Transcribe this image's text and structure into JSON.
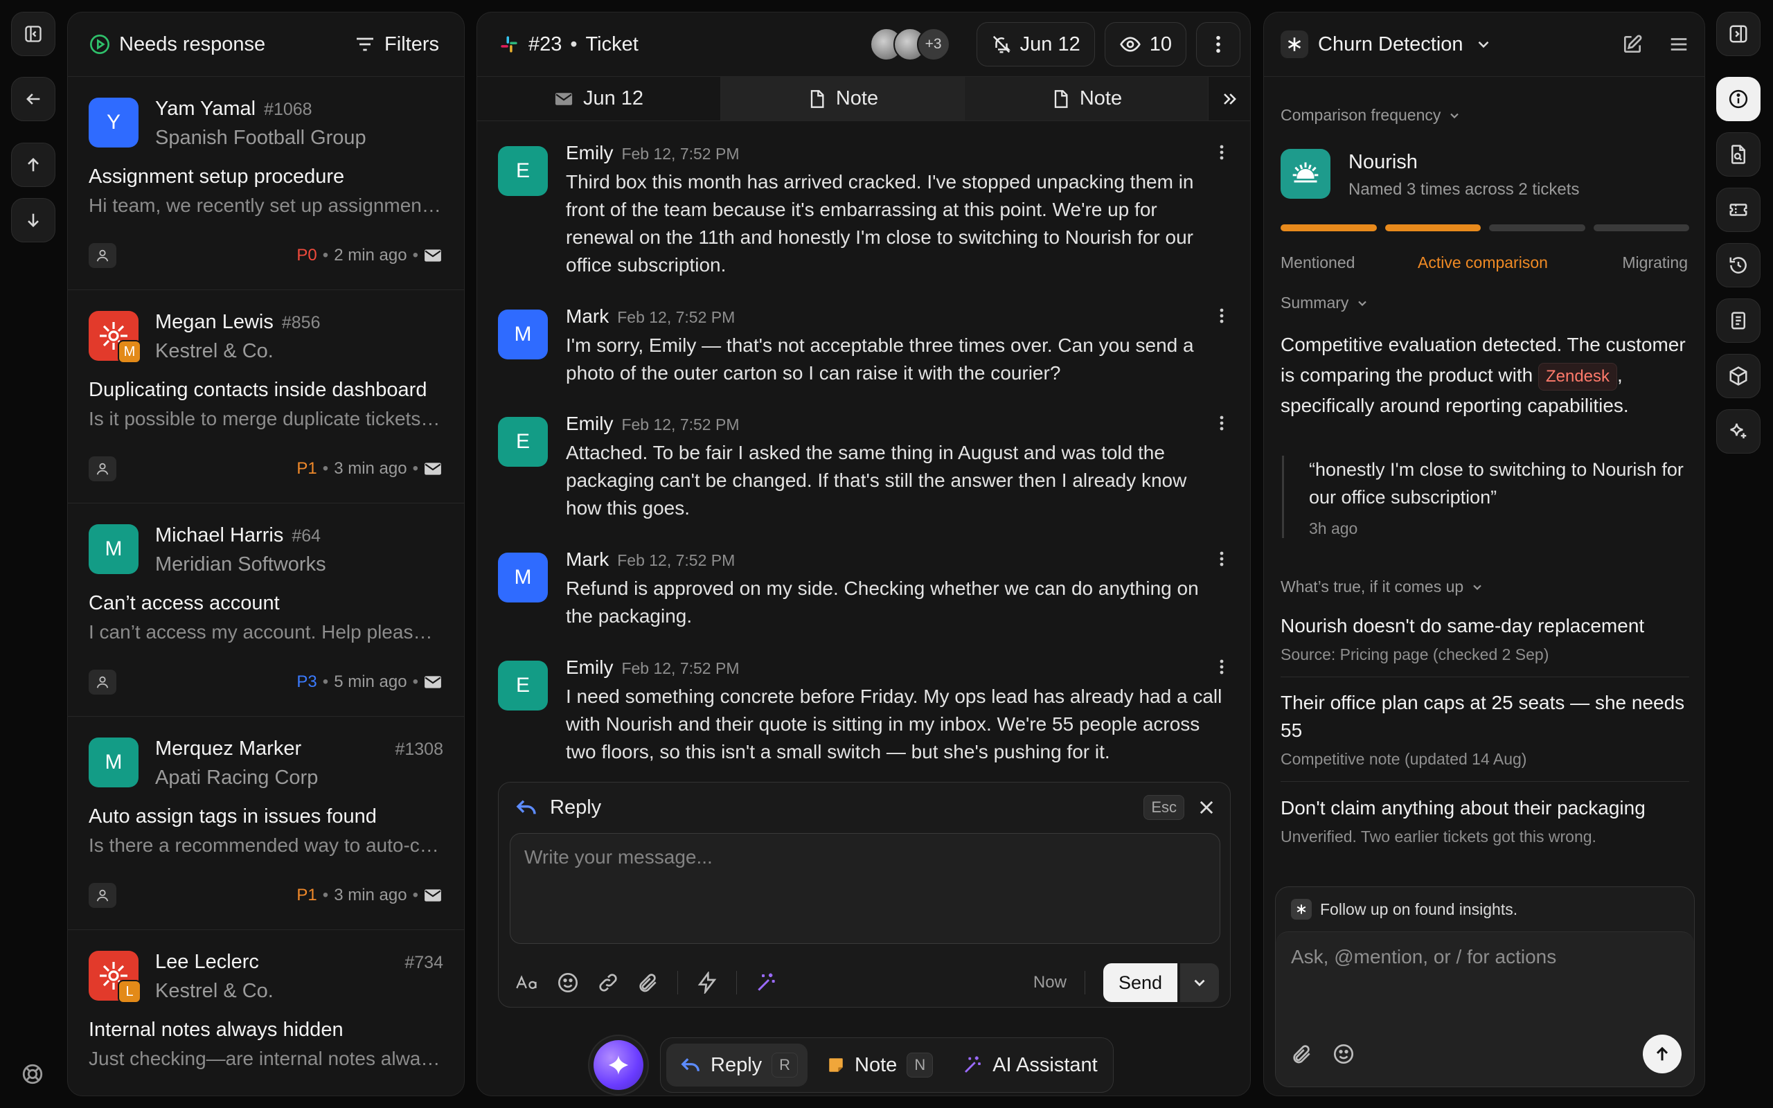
{
  "inbox": {
    "title": "Needs response",
    "filters_label": "Filters",
    "tickets": [
      {
        "initial": "Y",
        "avatar_color": "#2f6bff",
        "name": "Yam Yamal",
        "number": "#1068",
        "company": "Spanish Football Group",
        "subject": "Assignment setup procedure",
        "preview": "Hi team, we recently set up assignment rules for the support queue",
        "priority": "P0",
        "priority_color": "#ef4a3c",
        "time": "2 min ago"
      },
      {
        "initial": "M",
        "avatar_color": "#e23a2b",
        "name": "Megan Lewis",
        "number": "#856",
        "company": "Kestrel & Co.",
        "subject": "Duplicating contacts inside dashboard",
        "preview": "Is it possible to merge duplicate tickets from the same contact",
        "priority": "P1",
        "priority_color": "#f0892a",
        "time": "3 min ago"
      },
      {
        "initial": "M",
        "avatar_color": "#139c86",
        "name": "Michael Harris",
        "number": "#64",
        "company": "Meridian Softworks",
        "subject": "Can’t access account",
        "preview": "I can’t access my account. Help please, I have tried resetting",
        "priority": "P3",
        "priority_color": "#3b7bff",
        "time": "5 min ago"
      },
      {
        "initial": "M",
        "avatar_color": "#139c86",
        "name": "Merquez Marker",
        "number": "#1308",
        "company": "Apati Racing Corp",
        "subject": "Auto assign tags in issues found",
        "preview": "Is there a recommended way to auto-compose tags for new issues",
        "priority": "P1",
        "priority_color": "#f0892a",
        "time": "3 min ago"
      },
      {
        "initial": "L",
        "avatar_color": "#e23a2b",
        "name": "Lee Leclerc",
        "number": "#734",
        "company": "Kestrel & Co.",
        "subject": "Internal notes always hidden",
        "preview": "Just checking—are internal notes always hidden from customers",
        "priority": "",
        "priority_color": "#f0892a",
        "time": ""
      }
    ]
  },
  "thread": {
    "ticket_number": "#23",
    "ticket_label": "Ticket",
    "extra_watchers": "+3",
    "snooze_date": "Jun 12",
    "viewers": "10",
    "tabs": [
      {
        "label": "Jun 12"
      },
      {
        "label": "Note"
      },
      {
        "label": "Note"
      }
    ],
    "messages": [
      {
        "initial": "E",
        "color": "#139c86",
        "name": "Emily",
        "time": "Feb 12, 7:52 PM",
        "body": "Third box this month has arrived cracked. I've stopped unpacking them in front of the team because it's embarrassing at this point. We're up for renewal on the 11th and honestly I'm close to switching to Nourish for our office subscription."
      },
      {
        "initial": "M",
        "color": "#2f6bff",
        "name": "Mark",
        "time": "Feb 12, 7:52 PM",
        "body": "I'm sorry, Emily — that's not acceptable three times over. Can you send a photo of the outer carton so I can raise it with the courier?"
      },
      {
        "initial": "E",
        "color": "#139c86",
        "name": "Emily",
        "time": "Feb 12, 7:52 PM",
        "body": "Attached. To be fair I asked the same thing in August and was told the packaging can't be changed. If that's still the answer then I already know how this goes."
      },
      {
        "initial": "M",
        "color": "#2f6bff",
        "name": "Mark",
        "time": "Feb 12, 7:52 PM",
        "body": "Refund is approved on my side. Checking whether we can do anything on the packaging."
      },
      {
        "initial": "E",
        "color": "#139c86",
        "name": "Emily",
        "time": "Feb 12, 7:52 PM",
        "body": "I need something concrete before Friday. My ops lead has already had a call with Nourish and their quote is sitting in my inbox. We're 55 people across two floors, so this isn't a small switch — but she's pushing for it."
      }
    ],
    "composer": {
      "label": "Reply",
      "esc": "Esc",
      "placeholder": "Write your message...",
      "now": "Now",
      "send": "Send"
    },
    "modes": [
      {
        "label": "Reply",
        "key": "R"
      },
      {
        "label": "Note",
        "key": "N"
      },
      {
        "label": "AI Assistant",
        "key": ""
      }
    ]
  },
  "churn": {
    "title": "Churn Detection",
    "comparison_label": "Comparison frequency",
    "competitor_name": "Nourish",
    "competitor_sub": "Named 3 times across 2 tickets",
    "stages": [
      "Mentioned",
      "Active comparison",
      "Migrating"
    ],
    "active_stage": 2,
    "summary_label": "Summary",
    "summary_pre": "Competitive evaluation detected. The customer is comparing the product with",
    "summary_tag": "Zendesk",
    "summary_post": ", specifically around reporting capabilities.",
    "quote": "“honestly I'm close to switching to Nourish for our office subscription”",
    "quote_time": "3h ago",
    "facts_label": "What’s true, if it comes up",
    "facts": [
      {
        "title": "Nourish doesn't do same-day replacement",
        "source": "Source: Pricing page (checked 2 Sep)"
      },
      {
        "title": "Their office plan caps at 25 seats — she needs 55",
        "source": "Competitive note (updated 14 Aug)"
      },
      {
        "title": "Don't claim anything about their packaging",
        "source": "Unverified. Two earlier tickets got this wrong."
      }
    ],
    "ai_tip": "Follow up on found insights.",
    "ai_placeholder": "Ask, @mention, or / for actions"
  }
}
